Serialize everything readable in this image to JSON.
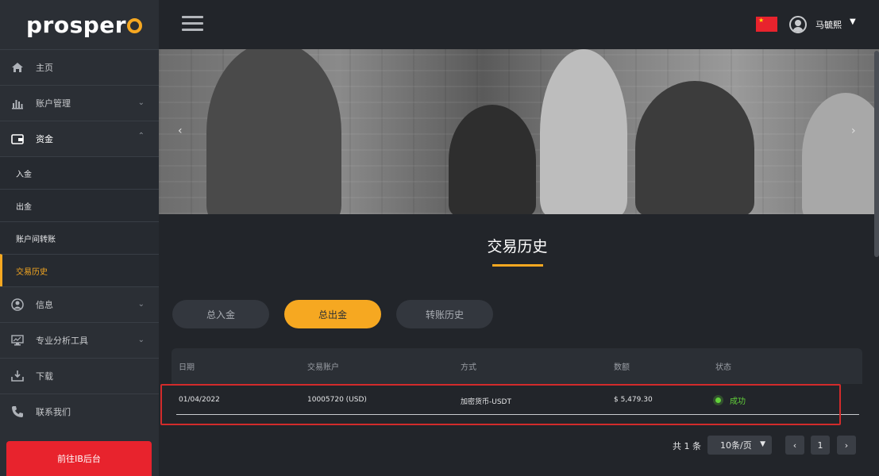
{
  "brand": {
    "logo_text": "prosper"
  },
  "header": {
    "flag": "china-flag",
    "user_name": "马毓熙"
  },
  "sidebar": {
    "items": [
      {
        "label": "主页",
        "icon": "home-icon"
      },
      {
        "label": "账户管理",
        "icon": "bar-chart-icon"
      },
      {
        "label": "资金",
        "icon": "wallet-icon"
      },
      {
        "label": "信息",
        "icon": "user-icon"
      },
      {
        "label": "专业分析工具",
        "icon": "monitor-icon"
      },
      {
        "label": "下载",
        "icon": "download-icon"
      },
      {
        "label": "联系我们",
        "icon": "phone-icon"
      }
    ],
    "sub_items": [
      {
        "label": "入金"
      },
      {
        "label": "出金"
      },
      {
        "label": "账户间转账"
      },
      {
        "label": "交易历史"
      }
    ],
    "ib_button": "前往IB后台"
  },
  "page": {
    "title": "交易历史"
  },
  "tabs": [
    {
      "label": "总入金"
    },
    {
      "label": "总出金"
    },
    {
      "label": "转账历史"
    }
  ],
  "table": {
    "columns": [
      "日期",
      "交易账户",
      "方式",
      "数额",
      "状态"
    ],
    "rows": [
      {
        "date": "01/04/2022",
        "account": "10005720 (USD)",
        "method": "加密货币-USDT",
        "amount": "$ 5,479.30",
        "status": "成功"
      }
    ]
  },
  "pagination": {
    "total": "共 1 条",
    "per_page": "10条/页",
    "page": "1"
  },
  "colors": {
    "accent": "#f6a821",
    "danger": "#e8232d",
    "success": "#62d13a"
  }
}
